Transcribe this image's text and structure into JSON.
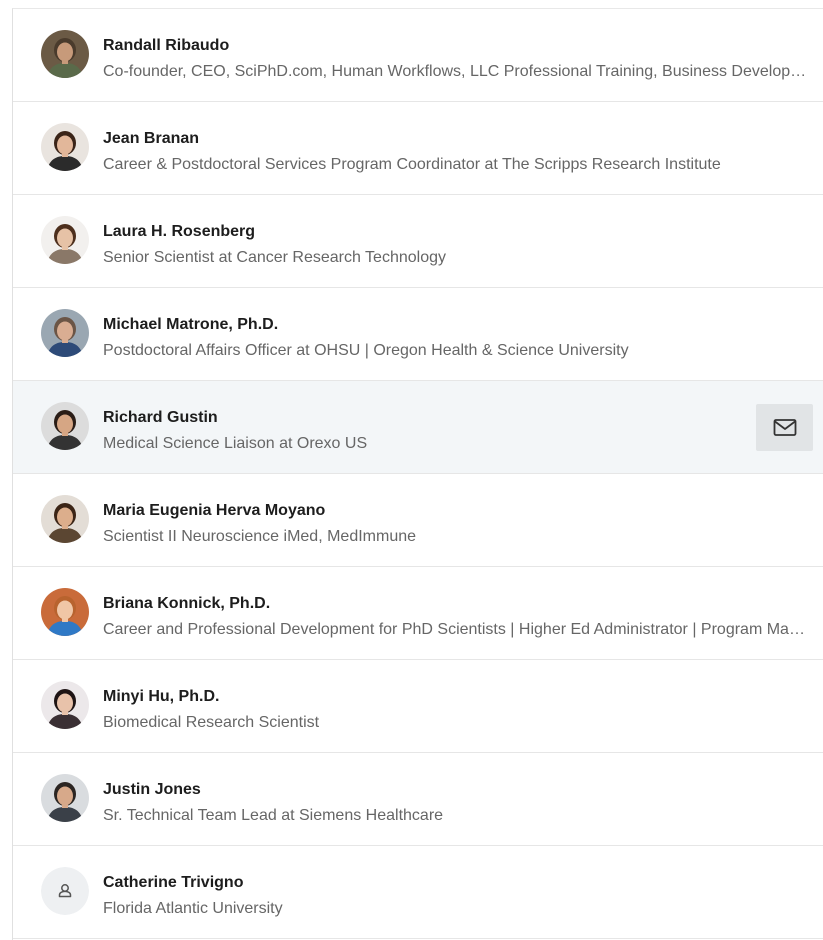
{
  "connections": [
    {
      "name": "Randall Ribaudo",
      "headline": "Co-founder, CEO, SciPhD.com, Human Workflows, LLC Professional Training, Business Development, and Consulting Services",
      "avatar": {
        "bg": "#6b5a45",
        "skin": "#c79a7a",
        "hair": "#4a3b2c",
        "shirt": "#5a6a4a"
      }
    },
    {
      "name": "Jean Branan",
      "headline": "Career & Postdoctoral Services Program Coordinator at The Scripps Research Institute",
      "avatar": {
        "bg": "#e9e4df",
        "skin": "#e2b79a",
        "hair": "#3a2418",
        "shirt": "#2b2b2b"
      }
    },
    {
      "name": "Laura H. Rosenberg",
      "headline": "Senior Scientist at Cancer Research Technology",
      "avatar": {
        "bg": "#f2f0ee",
        "skin": "#e6c2a6",
        "hair": "#4d2f1d",
        "shirt": "#8a7868"
      }
    },
    {
      "name": "Michael Matrone, Ph.D.",
      "headline": "Postdoctoral Affairs Officer at OHSU | Oregon Health & Science University",
      "avatar": {
        "bg": "#9aa7b2",
        "skin": "#d9ad92",
        "hair": "#6b5546",
        "shirt": "#2d4a78"
      }
    },
    {
      "name": "Richard Gustin",
      "headline": "Medical Science Liaison at Orexo US",
      "avatar": {
        "bg": "#dcdcdc",
        "skin": "#d6a684",
        "hair": "#2a1d16",
        "shirt": "#333333"
      },
      "hover": true
    },
    {
      "name": "Maria Eugenia Herva Moyano",
      "headline": "Scientist II Neuroscience iMed, MedImmune",
      "avatar": {
        "bg": "#e3ddd6",
        "skin": "#dcae8c",
        "hair": "#3b2416",
        "shirt": "#5b4632"
      }
    },
    {
      "name": "Briana Konnick, Ph.D.",
      "headline": "Career and Professional Development for PhD Scientists | Higher Ed Administrator | Program Manager",
      "avatar": {
        "bg": "#c96b3a",
        "skin": "#f0c6a6",
        "hair": "#b8632e",
        "shirt": "#2f79c6"
      }
    },
    {
      "name": "Minyi Hu, Ph.D.",
      "headline": "Biomedical Research Scientist",
      "avatar": {
        "bg": "#ece8ea",
        "skin": "#e8c2aa",
        "hair": "#1e1414",
        "shirt": "#3a2f33"
      }
    },
    {
      "name": "Justin Jones",
      "headline": "Sr. Technical Team Lead at Siemens Healthcare",
      "avatar": {
        "bg": "#d9dcdf",
        "skin": "#d7a98a",
        "hair": "#2b2522",
        "shirt": "#3a4048"
      }
    },
    {
      "name": "Catherine Trivigno",
      "headline": "Florida Atlantic University",
      "avatar": {
        "placeholder": true,
        "bg": "#eef0f2",
        "icon": "person-icon"
      }
    }
  ],
  "actions": {
    "message_icon": "envelope-icon"
  },
  "colors": {
    "name_text": "#1d1d1d",
    "headline_text": "#666666",
    "divider": "#e6e6e6",
    "hover_row_bg": "#f3f6f8",
    "message_button_bg": "#e1e4e6"
  }
}
